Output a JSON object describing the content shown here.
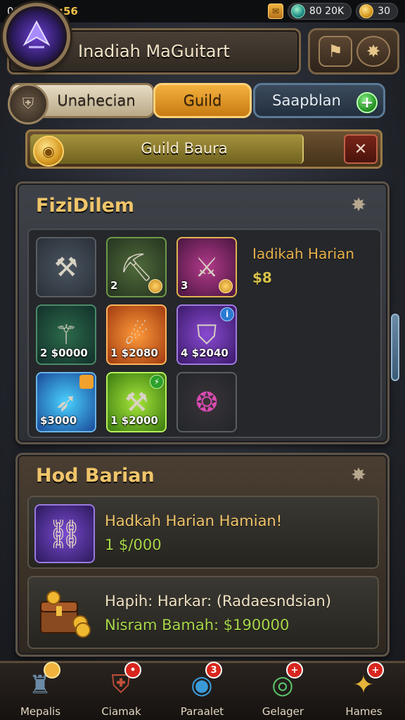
{
  "status_bar": {
    "left_text": "09",
    "clock": "11:56",
    "gem_count": "80 20K",
    "gold_count": "30"
  },
  "header": {
    "title": "Inadiah MaGuitart",
    "avatar_icon": "rune-emblem-icon",
    "button_1_icon": "banner-icon",
    "button_2_icon": "gear-icon"
  },
  "tabs": [
    {
      "label": "Unahecian",
      "icon": "shield-crest-icon",
      "active": false
    },
    {
      "label": "Guild",
      "active": true
    },
    {
      "label": "Saapblan",
      "active": false
    }
  ],
  "guild_bar": {
    "label": "Guild Baura",
    "progress": 0.88
  },
  "inventory": {
    "title": "FiziDilem",
    "selected_item": {
      "name": "Iadikah Harian",
      "price": "$8"
    },
    "slots": [
      {
        "icon": "crossed-axes-icon",
        "qty": "",
        "rarity": "gray"
      },
      {
        "icon": "armored-gauntlet-icon",
        "qty": "2",
        "rarity": "green"
      },
      {
        "icon": "golden-hammer-icon",
        "qty": "3",
        "rarity": "gold"
      },
      {
        "icon": "serpent-weapon-icon",
        "qty": "2 $0000",
        "rarity": "teal"
      },
      {
        "icon": "flaming-scythe-icon",
        "qty": "1 $2080",
        "rarity": "orange"
      },
      {
        "icon": "purple-shield-icon",
        "qty": "4 $2040",
        "rarity": "purple"
      },
      {
        "icon": "ice-bow-icon",
        "qty": "$3000",
        "rarity": "blue"
      },
      {
        "icon": "war-hammer-icon",
        "qty": "1 $2000",
        "rarity": "lime"
      },
      {
        "icon": "magic-amulet-icon",
        "qty": "",
        "rarity": "dark"
      }
    ]
  },
  "offers": {
    "title": "Hod Barian",
    "items": [
      {
        "line1": "Hadkah Harian Hamian!",
        "line2": "1 $/000",
        "icon": "purple-gauntlet-icon"
      },
      {
        "line1": "Hapih: Harkar: (Radaesndsian)",
        "line2": "Nisram Bamah: $190000",
        "icon": "treasure-chest-icon"
      }
    ]
  },
  "bottom_nav": [
    {
      "label": "Mepalis",
      "icon": "castle-icon",
      "badge": ""
    },
    {
      "label": "Ciamak",
      "icon": "shield-icon",
      "badge": "•"
    },
    {
      "label": "Paraalet",
      "icon": "blue-orb-icon",
      "badge": "3"
    },
    {
      "label": "Gelager",
      "icon": "green-orb-icon",
      "badge": "+"
    },
    {
      "label": "Hames",
      "icon": "gold-crest-icon",
      "badge": "+"
    }
  ],
  "colors": {
    "accent_gold": "#f4b13d",
    "title_gold": "#f0c56a",
    "price_green": "#a8d84a",
    "panel_bg": "#2c2f34"
  }
}
